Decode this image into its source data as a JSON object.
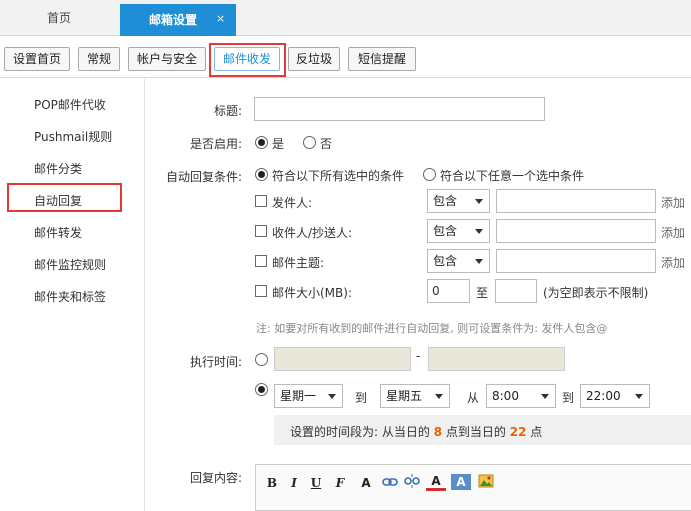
{
  "tabs": {
    "home": "首页",
    "active": "邮箱设置",
    "close": "×"
  },
  "subnav": [
    "设置首页",
    "常规",
    "帐户与安全",
    "邮件收发",
    "反垃圾",
    "短信提醒"
  ],
  "leftnav": [
    "POP邮件代收",
    "Pushmail规则",
    "邮件分类",
    "自动回复",
    "邮件转发",
    "邮件监控规则",
    "邮件夹和标签"
  ],
  "form": {
    "title_label": "标题:",
    "title_value": "",
    "enable_label": "是否启用:",
    "enable_yes": "是",
    "enable_no": "否",
    "cond_label": "自动回复条件:",
    "cond_all": "符合以下所有选中的条件",
    "cond_any": "符合以下任意一个选中条件",
    "sender": "发件人:",
    "recipient": "收件人/抄送人:",
    "subject": "邮件主题:",
    "size": "邮件大小(MB):",
    "contains": "包含",
    "add_text": "添加",
    "size_from": "0",
    "size_to_label": "至",
    "size_hint": "(为空即表示不限制)",
    "note": "注: 如要对所有收到的邮件进行自动回复, 则可设置条件为: 发件人包含@",
    "exec_label": "执行时间:",
    "dash": "-",
    "day_from": "星期一",
    "day_to": "星期五",
    "to1": "到",
    "from_label": "从",
    "time_from": "8:00",
    "to2": "到",
    "time_to": "22:00",
    "info_prefix": "设置的时间段为: 从当日的",
    "info_start": "8",
    "info_mid": "点到当日的",
    "info_end": "22",
    "info_suffix": "点",
    "reply_label": "回复内容:"
  },
  "editor": {
    "bold": "B",
    "italic": "I",
    "underline": "U",
    "font": "F",
    "size": "A"
  },
  "colors": {
    "accent": "#1e8fd6",
    "highlight_box": "#e53935",
    "hour_highlight": "#e8640c"
  }
}
